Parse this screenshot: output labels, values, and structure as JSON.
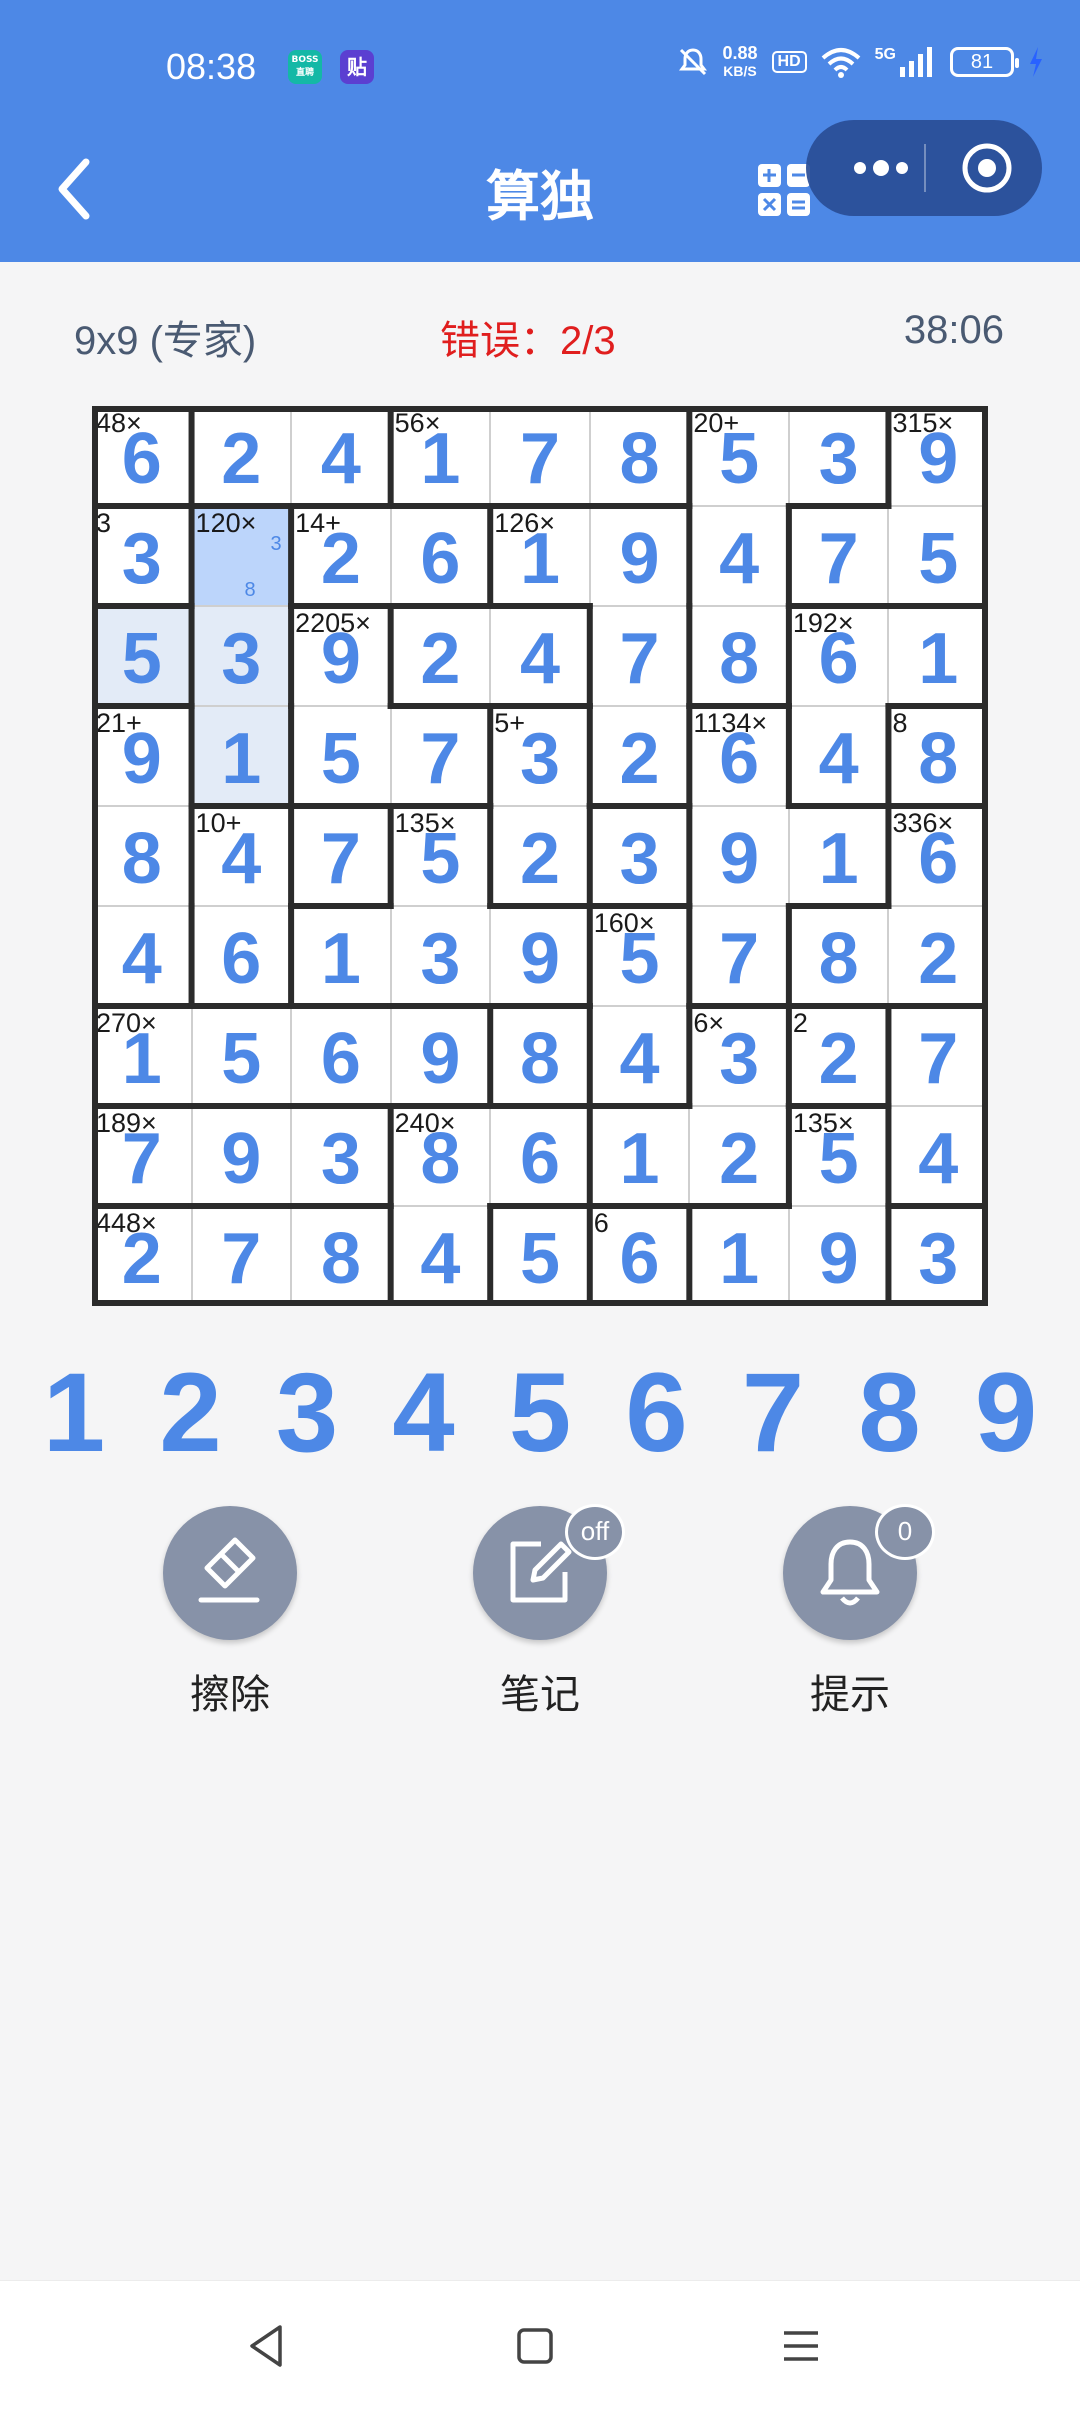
{
  "status_bar": {
    "time": "08:38",
    "app_icons": [
      {
        "name": "boss-app-icon",
        "label": "BOSS\n直聘",
        "color": "#14b8a6"
      },
      {
        "name": "tieba-app-icon",
        "label": "贴",
        "color": "#5b3fd1"
      }
    ],
    "net_speed_top": "0.88",
    "net_speed_unit": "KB/S",
    "hd": "HD",
    "network": "5G",
    "battery": "81"
  },
  "header": {
    "title": "算独",
    "icons": [
      "back-icon",
      "calculator-icon",
      "more-icon",
      "close-target-icon"
    ]
  },
  "game_info": {
    "size_level": "9x9 (专家)",
    "errors": "错误：2/3",
    "timer": "38:06"
  },
  "board": {
    "values": [
      [
        6,
        2,
        4,
        1,
        7,
        8,
        5,
        3,
        9
      ],
      [
        3,
        null,
        2,
        6,
        1,
        9,
        4,
        7,
        5
      ],
      [
        5,
        3,
        9,
        2,
        4,
        7,
        8,
        6,
        1
      ],
      [
        9,
        1,
        5,
        7,
        3,
        2,
        6,
        4,
        8
      ],
      [
        8,
        4,
        7,
        5,
        2,
        3,
        9,
        1,
        6
      ],
      [
        4,
        6,
        1,
        3,
        9,
        5,
        7,
        8,
        2
      ],
      [
        1,
        5,
        6,
        9,
        8,
        4,
        3,
        2,
        7
      ],
      [
        7,
        9,
        3,
        8,
        6,
        1,
        2,
        5,
        4
      ],
      [
        2,
        7,
        8,
        4,
        5,
        6,
        1,
        9,
        3
      ]
    ],
    "cages": [
      {
        "label": "48×",
        "cells": [
          [
            0,
            0
          ],
          [
            1,
            0
          ],
          [
            2,
            0
          ]
        ]
      },
      {
        "label": "",
        "cells": [
          [
            0,
            1
          ],
          [
            0,
            2
          ]
        ]
      },
      {
        "label": "56×",
        "cells": [
          [
            0,
            3
          ],
          [
            0,
            4
          ],
          [
            0,
            5
          ]
        ]
      },
      {
        "label": "20+",
        "cells": [
          [
            0,
            6
          ],
          [
            1,
            6
          ],
          [
            0,
            7
          ],
          [
            2,
            6
          ]
        ]
      },
      {
        "label": "315×",
        "cells": [
          [
            0,
            8
          ],
          [
            1,
            8
          ],
          [
            1,
            7
          ]
        ]
      },
      {
        "label": "3",
        "cells": [
          [
            1,
            0
          ]
        ]
      },
      {
        "label": "120×",
        "cells": [
          [
            1,
            1
          ],
          [
            2,
            1
          ],
          [
            3,
            1
          ]
        ]
      },
      {
        "label": "14+",
        "cells": [
          [
            1,
            2
          ],
          [
            1,
            3
          ]
        ]
      },
      {
        "label": "126×",
        "cells": [
          [
            1,
            4
          ],
          [
            1,
            5
          ],
          [
            2,
            5
          ],
          [
            3,
            5
          ]
        ]
      },
      {
        "label": "2205×",
        "cells": [
          [
            2,
            2
          ],
          [
            3,
            2
          ],
          [
            3,
            3
          ]
        ]
      },
      {
        "label": "",
        "cells": [
          [
            2,
            3
          ],
          [
            2,
            4
          ]
        ]
      },
      {
        "label": "192×",
        "cells": [
          [
            2,
            7
          ],
          [
            3,
            7
          ],
          [
            2,
            8
          ]
        ]
      },
      {
        "label": "21+",
        "cells": [
          [
            3,
            0
          ],
          [
            4,
            0
          ],
          [
            5,
            0
          ]
        ]
      },
      {
        "label": "5+",
        "cells": [
          [
            3,
            4
          ],
          [
            4,
            4
          ]
        ]
      },
      {
        "label": "1134×",
        "cells": [
          [
            3,
            6
          ],
          [
            4,
            6
          ],
          [
            5,
            6
          ],
          [
            4,
            7
          ]
        ]
      },
      {
        "label": "8",
        "cells": [
          [
            3,
            8
          ]
        ]
      },
      {
        "label": "10+",
        "cells": [
          [
            4,
            1
          ],
          [
            5,
            1
          ]
        ]
      },
      {
        "label": "",
        "cells": [
          [
            4,
            2
          ]
        ]
      },
      {
        "label": "135×",
        "cells": [
          [
            4,
            3
          ],
          [
            5,
            3
          ],
          [
            5,
            2
          ],
          [
            5,
            4
          ]
        ]
      },
      {
        "label": "",
        "cells": [
          [
            4,
            5
          ]
        ]
      },
      {
        "label": "336×",
        "cells": [
          [
            4,
            8
          ],
          [
            5,
            8
          ],
          [
            5,
            7
          ]
        ]
      },
      {
        "label": "160×",
        "cells": [
          [
            5,
            5
          ],
          [
            6,
            5
          ]
        ]
      },
      {
        "label": "270×",
        "cells": [
          [
            6,
            0
          ],
          [
            6,
            1
          ],
          [
            6,
            2
          ],
          [
            6,
            3
          ]
        ]
      },
      {
        "label": "",
        "cells": [
          [
            6,
            4
          ]
        ]
      },
      {
        "label": "6×",
        "cells": [
          [
            6,
            6
          ],
          [
            7,
            6
          ],
          [
            7,
            5
          ]
        ]
      },
      {
        "label": "2",
        "cells": [
          [
            6,
            7
          ]
        ]
      },
      {
        "label": "",
        "cells": [
          [
            6,
            8
          ],
          [
            7,
            8
          ]
        ]
      },
      {
        "label": "189×",
        "cells": [
          [
            7,
            0
          ],
          [
            7,
            1
          ],
          [
            7,
            2
          ]
        ]
      },
      {
        "label": "240×",
        "cells": [
          [
            7,
            3
          ],
          [
            7,
            4
          ],
          [
            8,
            3
          ]
        ]
      },
      {
        "label": "135×",
        "cells": [
          [
            7,
            7
          ],
          [
            8,
            7
          ],
          [
            8,
            6
          ]
        ]
      },
      {
        "label": "448×",
        "cells": [
          [
            8,
            0
          ],
          [
            8,
            1
          ],
          [
            8,
            2
          ]
        ]
      },
      {
        "label": "",
        "cells": [
          [
            8,
            4
          ]
        ]
      },
      {
        "label": "6",
        "cells": [
          [
            8,
            5
          ]
        ]
      },
      {
        "label": "",
        "cells": [
          [
            8,
            8
          ]
        ]
      }
    ],
    "selected": [
      1,
      1
    ],
    "highlighted": [
      [
        2,
        0
      ],
      [
        2,
        1
      ],
      [
        3,
        1
      ]
    ],
    "notes": {
      "1,1": [
        "3",
        "8"
      ]
    }
  },
  "numpad": [
    "1",
    "2",
    "3",
    "4",
    "5",
    "6",
    "7",
    "8",
    "9"
  ],
  "tools": [
    {
      "name": "erase",
      "label": "擦除",
      "icon": "eraser-icon",
      "badge": ""
    },
    {
      "name": "notes",
      "label": "笔记",
      "icon": "edit-note-icon",
      "badge": "off"
    },
    {
      "name": "hint",
      "label": "提示",
      "icon": "bell-icon",
      "badge": "0"
    }
  ],
  "nav_bar": [
    "back-triangle-icon",
    "home-square-icon",
    "menu-lines-icon"
  ],
  "colors": {
    "accent": "#4d88e6",
    "error": "#e01e1e",
    "selected": "#bcd5fb",
    "tool": "#8792a8"
  }
}
